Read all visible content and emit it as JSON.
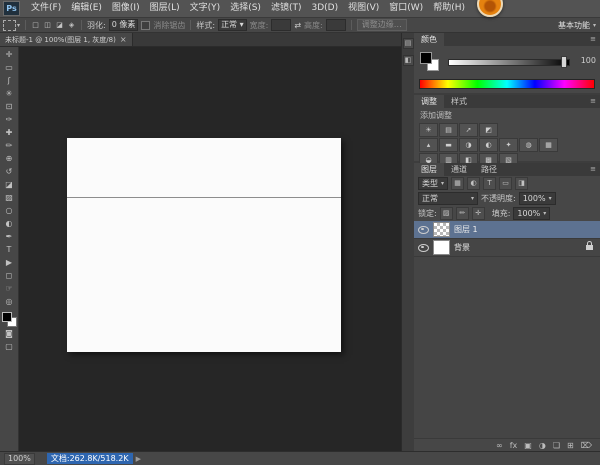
{
  "colors": {
    "menu_bg": "#535353",
    "panel_bg": "#474747",
    "canvas_bg": "#262626",
    "accent_blue": "#2e66b0",
    "selected_layer_bg": "#5d7291",
    "document_bg": "#fbfbfb"
  },
  "menu_bar": {
    "logo": "Ps",
    "items": [
      "文件(F)",
      "编辑(E)",
      "图像(I)",
      "图层(L)",
      "文字(Y)",
      "选择(S)",
      "滤镜(T)",
      "3D(D)",
      "视图(V)",
      "窗口(W)",
      "帮助(H)"
    ]
  },
  "options_bar": {
    "mode_icons": [
      "□",
      "◫",
      "◪",
      "◈"
    ],
    "feather_label": "羽化:",
    "feather_value": "0 像素",
    "antialias_label": "消除锯齿",
    "style_label": "样式:",
    "style_value": "正常",
    "width_label": "宽度:",
    "swap_icon": "⇄",
    "height_label": "高度:",
    "refine_edge": "调整边缘…",
    "workspace": "基本功能",
    "caret": "▾"
  },
  "document_tab": {
    "title": "未标题-1 @ 100%(图层 1, 灰度/8)",
    "close": "×"
  },
  "toolbar": {
    "tools": [
      {
        "name": "move",
        "glyph": "✛"
      },
      {
        "name": "rect-marquee",
        "glyph": "▭"
      },
      {
        "name": "lasso",
        "glyph": "ʃ"
      },
      {
        "name": "quick-select",
        "glyph": "✳"
      },
      {
        "name": "crop",
        "glyph": "⊡"
      },
      {
        "name": "eyedropper",
        "glyph": "✑"
      },
      {
        "name": "spot-heal",
        "glyph": "✚"
      },
      {
        "name": "brush",
        "glyph": "✏"
      },
      {
        "name": "clone-stamp",
        "glyph": "⊕"
      },
      {
        "name": "history-brush",
        "glyph": "↺"
      },
      {
        "name": "eraser",
        "glyph": "◪"
      },
      {
        "name": "gradient",
        "glyph": "▨"
      },
      {
        "name": "blur",
        "glyph": "○"
      },
      {
        "name": "dodge",
        "glyph": "◐"
      },
      {
        "name": "pen",
        "glyph": "✒"
      },
      {
        "name": "type",
        "glyph": "T"
      },
      {
        "name": "path-select",
        "glyph": "▶"
      },
      {
        "name": "shape",
        "glyph": "◻"
      },
      {
        "name": "hand",
        "glyph": "☞"
      },
      {
        "name": "zoom",
        "glyph": "◎"
      }
    ],
    "quick-mask_glyph": "◙",
    "screen-mode_glyph": "▢"
  },
  "dock_strip": {
    "icons": [
      "▤",
      "◧"
    ]
  },
  "color_panel": {
    "tab": "颜色",
    "menu_icon": "≡",
    "value": "100"
  },
  "adjustments_panel": {
    "tabs": [
      "调整",
      "样式"
    ],
    "menu_icon": "≡",
    "add_label": "添加调整",
    "icons": [
      {
        "name": "brightness-contrast",
        "glyph": "☀"
      },
      {
        "name": "levels",
        "glyph": "▤"
      },
      {
        "name": "curves",
        "glyph": "➚"
      },
      {
        "name": "exposure",
        "glyph": "◩"
      },
      {
        "name": "vibrance",
        "glyph": "▴"
      },
      {
        "name": "hue-saturation",
        "glyph": "▬"
      },
      {
        "name": "color-balance",
        "glyph": "◑"
      },
      {
        "name": "black-white",
        "glyph": "◐"
      },
      {
        "name": "photo-filter",
        "glyph": "✦"
      },
      {
        "name": "channel-mixer",
        "glyph": "◍"
      },
      {
        "name": "color-lookup",
        "glyph": "▦"
      },
      {
        "name": "invert",
        "glyph": "◒"
      },
      {
        "name": "posterize",
        "glyph": "▥"
      },
      {
        "name": "threshold",
        "glyph": "◧"
      },
      {
        "name": "gradient-map",
        "glyph": "▩"
      },
      {
        "name": "selective-color",
        "glyph": "▧"
      }
    ]
  },
  "layers_panel": {
    "tabs": [
      "图层",
      "通道",
      "路径"
    ],
    "menu_icon": "≡",
    "filter_kind_label": "类型",
    "filter_icons": [
      "▦",
      "◐",
      "T",
      "▭",
      "◨"
    ],
    "blend_mode": "正常",
    "opacity_label": "不透明度:",
    "opacity_value": "100%",
    "lock_label": "锁定:",
    "lock_icons": [
      "▨",
      "✏",
      "✛"
    ],
    "fill_label": "填充:",
    "fill_value": "100%",
    "rows": [
      {
        "name": "图层 1",
        "selected": true
      },
      {
        "name": "背景",
        "locked": true
      }
    ],
    "bottom_icons": [
      {
        "name": "link-layers",
        "glyph": "∞"
      },
      {
        "name": "layer-style",
        "glyph": "fx"
      },
      {
        "name": "layer-mask",
        "glyph": "▣"
      },
      {
        "name": "adjustment-layer",
        "glyph": "◑"
      },
      {
        "name": "new-group",
        "glyph": "❏"
      },
      {
        "name": "new-layer",
        "glyph": "⊞"
      },
      {
        "name": "delete-layer",
        "glyph": "⌦"
      }
    ]
  },
  "status_bar": {
    "zoom": "100%",
    "doc_info": "文档:262.8K/518.2K",
    "arrow": "▶"
  }
}
